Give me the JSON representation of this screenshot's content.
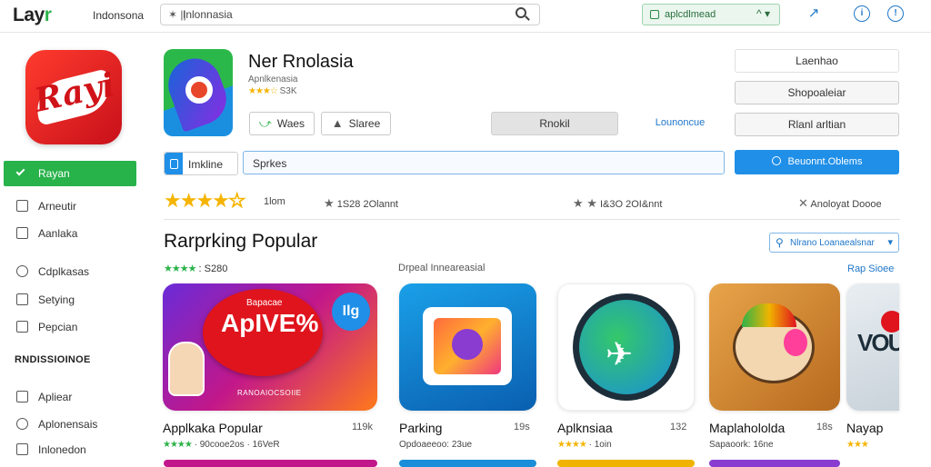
{
  "topbar": {
    "logo_main": "Lay",
    "logo_tail": "r",
    "region": "Indonsona",
    "search_prefix": "✶ ||",
    "search_value": "Inlonnasia",
    "account_label": "aplcdlmead",
    "account_caret": "^ ▾",
    "icon_share": "share-icon",
    "icon_info": "info-icon",
    "icon_alert": "alert-icon"
  },
  "sidebar": {
    "logo_text": "Rayi",
    "items": [
      {
        "label": "Rayan"
      },
      {
        "label": "Arneutir"
      },
      {
        "label": "Aanlaka"
      },
      {
        "label": "Cdplkasas"
      },
      {
        "label": "Setying"
      },
      {
        "label": "Pepcian"
      }
    ],
    "section": "RNDISSIOINOE",
    "items2": [
      {
        "label": "Apliear"
      },
      {
        "label": "Aplonensais"
      },
      {
        "label": "Inlonedon"
      }
    ]
  },
  "app": {
    "title": "Ner Rnolasia",
    "subtitle": "Apnlkenasia",
    "rating_stars": "★★★☆",
    "rating_count": "S3K",
    "btn_wave": "Waes",
    "btn_share": "Slaree",
    "btn_install": "Rnokil",
    "link_more": "Lounoncue",
    "side_btn_1": "Laenhao",
    "side_btn_2": "Shopoaleiar",
    "side_btn_3": "Rlanl arltian"
  },
  "searchrow": {
    "tab_label": "Imkline",
    "field_value": "Sprkes",
    "primary": "Beuonnt.Oblems"
  },
  "stats": {
    "stars": "★★★★",
    "stars_empty": "☆",
    "review_label": "1lom",
    "s1": "1S28 2Olannt",
    "s2": "I&3O 2OI&nnt",
    "s3": "Anoloyat Doooe"
  },
  "section": {
    "title": "Rarprking Popular",
    "stars": "★★★★",
    "rating": ": S280",
    "mid_label": "Drpeal Inneareasial",
    "filter_label": "Nlrano Loanaealsnar",
    "see_all": "Rap Sioee"
  },
  "cards": [
    {
      "name": "Applkaka Popular",
      "size": "119k",
      "meta_stars": "★★★★",
      "meta": "· 90cooe2os · 16VeR",
      "thumb_text": "ApIVE%",
      "thumb_top": "Bapacae",
      "thumb_bottom": "RANOAIOCSOIIE",
      "badge": "Ilg"
    },
    {
      "name": "Parking",
      "size": "19s",
      "meta_stars": "",
      "meta": "Opdoaeeoo: 23ue",
      "thumb_text": "",
      "thumb_top": "",
      "thumb_bottom": "",
      "badge": ""
    },
    {
      "name": "Aplknsiaa",
      "size": "132",
      "meta_stars": "★★★★",
      "meta": "· 1oin",
      "thumb_text": "",
      "thumb_top": "",
      "thumb_bottom": "",
      "badge": ""
    },
    {
      "name": "Maplahololda",
      "size": "18s",
      "meta_stars": "",
      "meta": "Sapaoork: 16ne",
      "thumb_text": "",
      "thumb_top": "",
      "thumb_bottom": "",
      "badge": ""
    },
    {
      "name": "Nayap",
      "size": "",
      "meta_stars": "★★★",
      "meta": "",
      "thumb_text": "VOU",
      "thumb_top": "",
      "thumb_bottom": "",
      "badge": ""
    }
  ]
}
